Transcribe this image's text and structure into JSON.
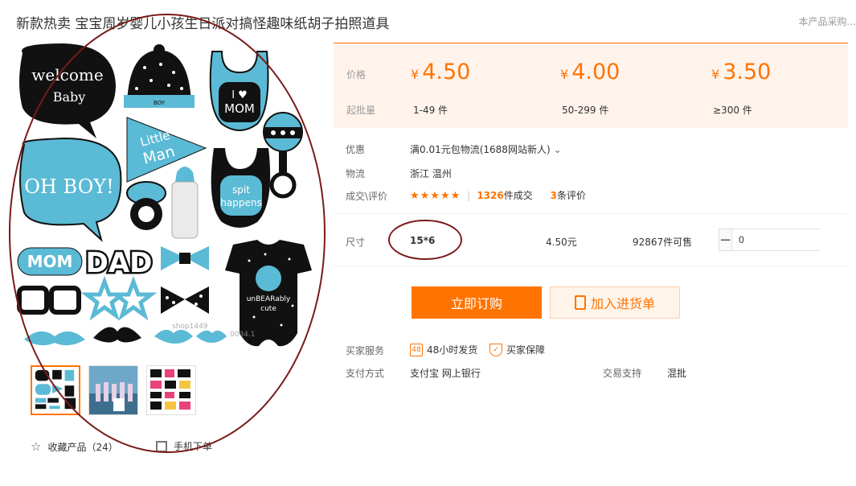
{
  "title": "新款热卖 宝宝周岁婴儿小孩生日派对搞怪趣味纸胡子拍照道具",
  "top_right": "本产品采购...",
  "price_section": {
    "price_label": "价格",
    "moq_label": "起批量",
    "currency": "¥",
    "tiers": [
      {
        "price": "4.50",
        "range": "1-49 件"
      },
      {
        "price": "4.00",
        "range": "50-299 件"
      },
      {
        "price": "3.50",
        "range": "≥300 件"
      }
    ]
  },
  "info": {
    "promo_label": "优惠",
    "promo_value": "满0.01元包物流(1688网站新人)",
    "logistics_label": "物流",
    "logistics_value": "浙江 温州",
    "deal_label": "成交\\评价",
    "stars": "★★★★★",
    "deals_count": "1326",
    "deals_suffix": "件成交",
    "reviews_count": "3",
    "reviews_suffix": "条评价"
  },
  "spec": {
    "label": "尺寸",
    "value": "15*6",
    "price": "4.50元",
    "stock": "92867件可售",
    "qty": "0"
  },
  "actions": {
    "buy": "立即订购",
    "cart": "加入进货单"
  },
  "service": {
    "label": "买家服务",
    "ship_icon_text": "48",
    "ship": "48小时发货",
    "guarantee": "买家保障"
  },
  "payment": {
    "label": "支付方式",
    "methods": "支付宝   网上银行",
    "support_label": "交易支持",
    "support_value": "混批"
  },
  "gallery": {
    "fav": "收藏产品（24）",
    "mobile": "手机下单"
  },
  "props": {
    "welcome": "welcome",
    "baby": "Baby",
    "ohboy": "OH BOY!",
    "little": "Little",
    "man": "Man",
    "ilove": "I ♥",
    "mom": "MOM",
    "spit": "spit",
    "happens": "happens",
    "dad": "DAD",
    "mom_glasses": "MOM",
    "unbearably": "unBEARably",
    "cute": "cute",
    "boy_tag": "BOY",
    "watermark1": "shop1449",
    "watermark2": "0034.1"
  },
  "colors": {
    "accent": "#ff7300",
    "prop_blue": "#5bbad5",
    "prop_black": "#111111",
    "ellipse": "#7a1a1a"
  }
}
